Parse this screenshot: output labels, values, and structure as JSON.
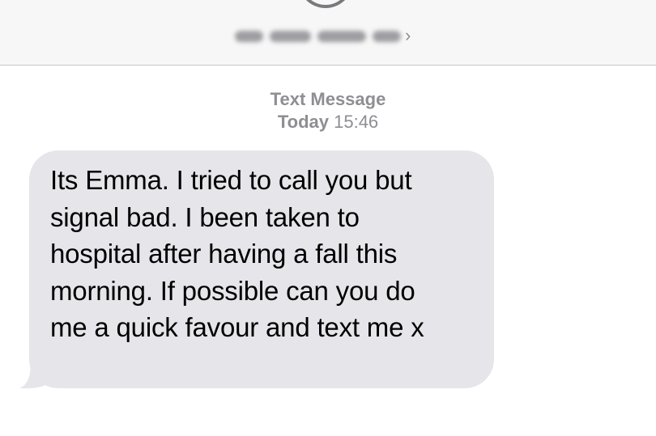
{
  "header": {
    "contact_icon": "person-avatar-icon",
    "chevron_icon": "chevron-right-icon",
    "chevron_glyph": "›"
  },
  "timestamp": {
    "kind": "Text Message",
    "day": "Today",
    "time": "15:46"
  },
  "message": {
    "text": "Its Emma. I tried to call you but\nsignal bad. I been taken to\nhospital after having a fall this\nmorning. If possible can you do\nme a quick favour and text me x"
  },
  "colors": {
    "bubble": "#e5e5ea",
    "timestamp": "#8e8e93",
    "header_bg": "#f7f7f7"
  }
}
